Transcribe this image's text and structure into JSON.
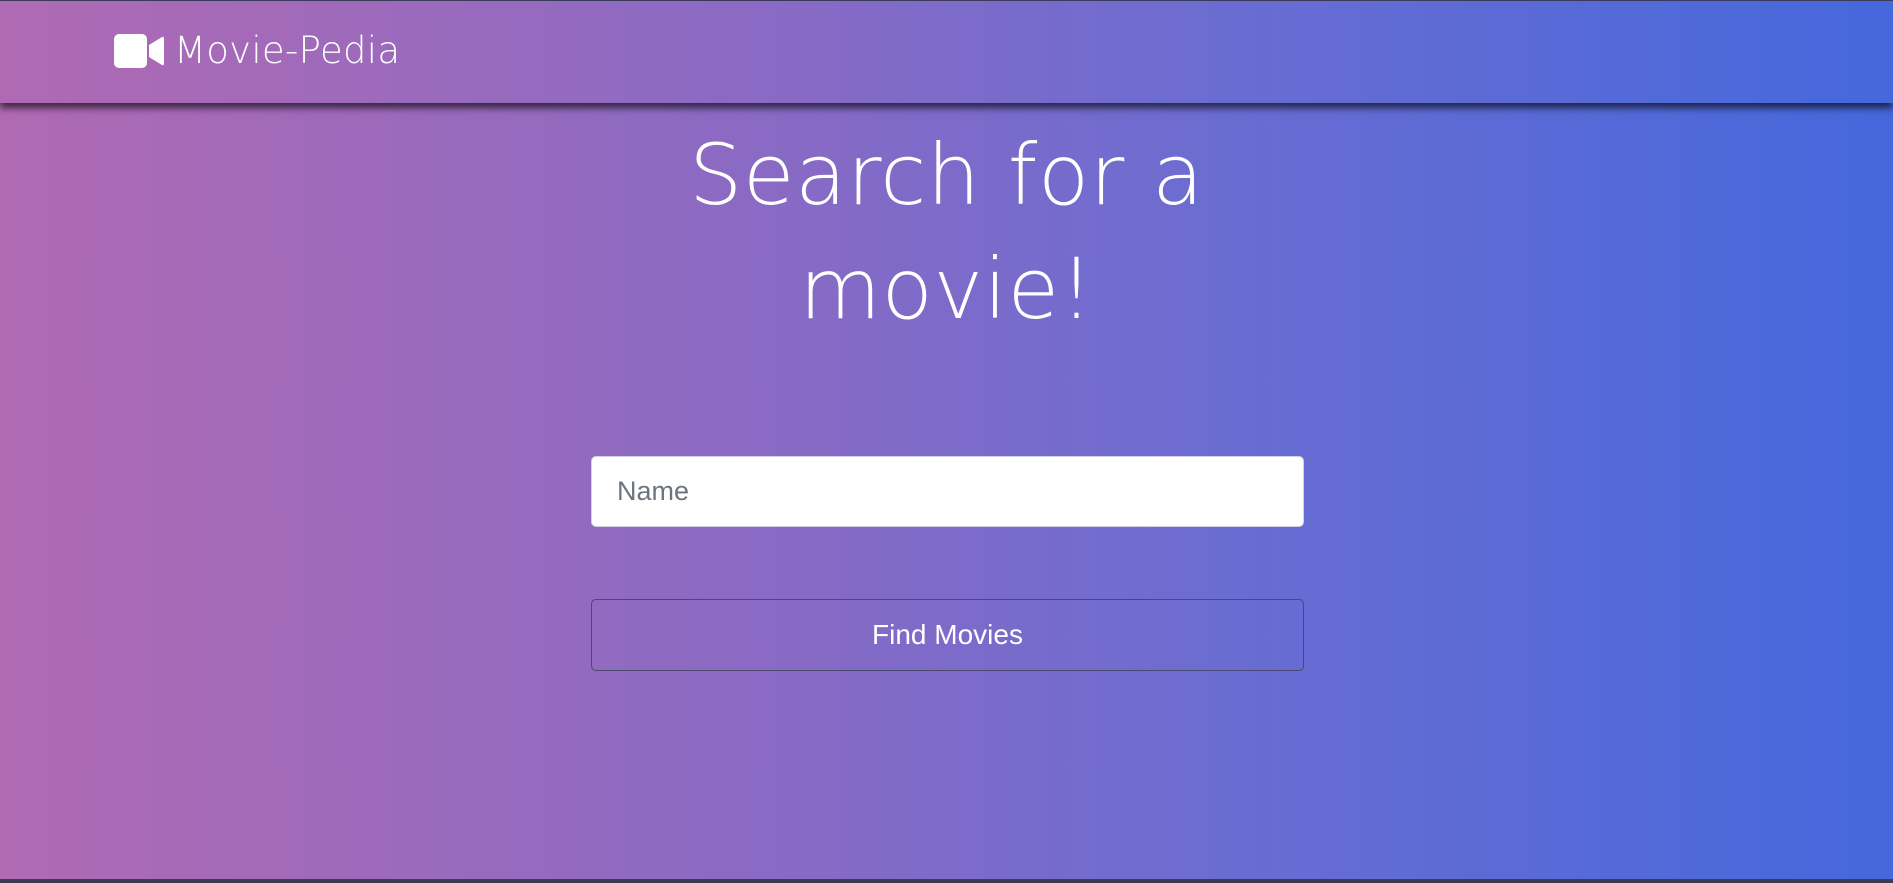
{
  "navbar": {
    "brand_icon": "video-camera-icon",
    "brand_text": "Movie-Pedia"
  },
  "hero": {
    "title": "Search for a movie!"
  },
  "search": {
    "placeholder": "Name",
    "value": ""
  },
  "actions": {
    "find_label": "Find Movies"
  },
  "colors": {
    "gradient_start": "#b06ab3",
    "gradient_end": "#4568dc",
    "text": "#ffffff"
  }
}
